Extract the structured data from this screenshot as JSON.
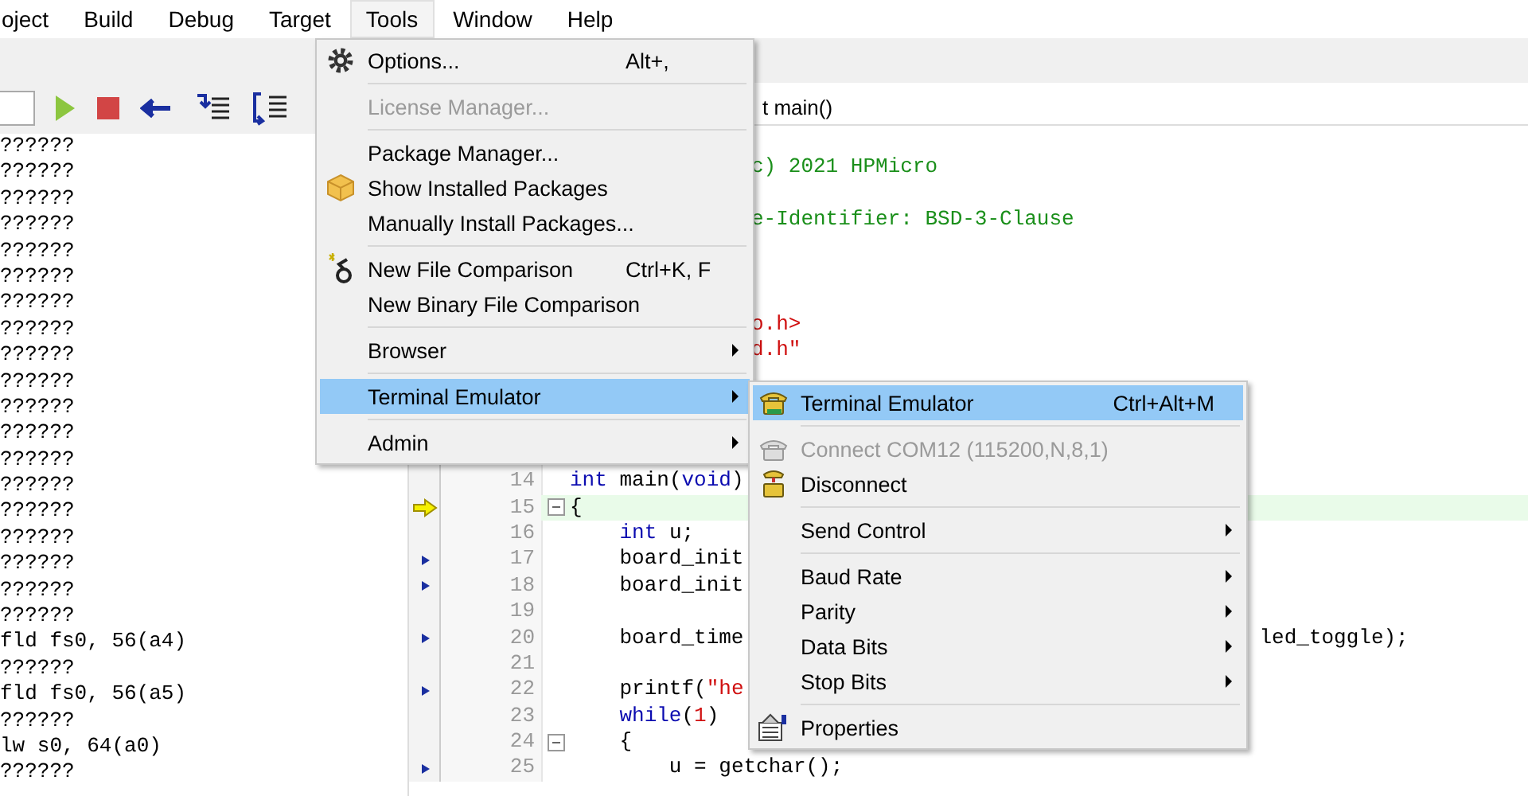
{
  "menubar": [
    {
      "label": "oject",
      "selected": false
    },
    {
      "label": "Build",
      "selected": false
    },
    {
      "label": "Debug",
      "selected": false
    },
    {
      "label": "Target",
      "selected": false
    },
    {
      "label": "Tools",
      "selected": true
    },
    {
      "label": "Window",
      "selected": false
    },
    {
      "label": "Help",
      "selected": false
    }
  ],
  "disassembly": {
    "lines": [
      "??????",
      "??????",
      "??????",
      "??????",
      "??????",
      "??????",
      "??????",
      "??????",
      "??????",
      "??????",
      "??????",
      "??????",
      "??????",
      "??????",
      "??????",
      "??????",
      "??????",
      "??????",
      "??????",
      "fld fs0, 56(a4)",
      "??????",
      "fld fs0, 56(a5)",
      "??????",
      "lw s0, 64(a0)",
      "??????"
    ]
  },
  "editor": {
    "function_box": "t main()",
    "fragments": [
      {
        "kind": "comment",
        "text": "c) 2021 HPMicro"
      },
      {
        "kind": "comment",
        "text": "e-Identifier: BSD-3-Clause"
      },
      {
        "kind": "include",
        "text": "o.h>"
      },
      {
        "kind": "include",
        "text": "d.h\""
      }
    ],
    "lines": [
      {
        "number": "14",
        "executable": false,
        "fold": false,
        "current": false,
        "text": "int main(void)"
      },
      {
        "number": "15",
        "fold": true,
        "current": true,
        "text": "{"
      },
      {
        "number": "16",
        "executable": false,
        "fold": false,
        "current": false,
        "text": "    int u;"
      },
      {
        "number": "17",
        "executable": true,
        "fold": false,
        "current": false,
        "text": "    board_init"
      },
      {
        "number": "18",
        "executable": true,
        "fold": false,
        "current": false,
        "text": "    board_init"
      },
      {
        "number": "19",
        "executable": false,
        "fold": false,
        "current": false
      },
      {
        "number": "20",
        "executable": true,
        "fold": false,
        "current": false,
        "text": "    board_time",
        "tail": "led_toggle);"
      },
      {
        "number": "21",
        "executable": false,
        "fold": false,
        "current": false
      },
      {
        "number": "22",
        "executable": true,
        "fold": false,
        "current": false,
        "text": "    printf(\"he"
      },
      {
        "number": "23",
        "executable": false,
        "fold": false,
        "current": false,
        "text": "    while(1)"
      },
      {
        "number": "24",
        "executable": false,
        "fold": true,
        "current": false,
        "text": "    {"
      },
      {
        "number": "25",
        "executable": true,
        "fold": false,
        "current": false,
        "text": "        u = getchar();"
      }
    ]
  },
  "tools_menu": {
    "items": [
      {
        "kind": "item",
        "label": "Options...",
        "shortcut": "Alt+,",
        "disabled": false,
        "selected": false,
        "submenu": false
      },
      {
        "kind": "separator"
      },
      {
        "kind": "item",
        "label": "License Manager...",
        "disabled": true,
        "selected": false,
        "submenu": false
      },
      {
        "kind": "separator"
      },
      {
        "kind": "item",
        "label": "Package Manager...",
        "disabled": false,
        "selected": false,
        "submenu": false
      },
      {
        "kind": "item",
        "label": "Show Installed Packages",
        "disabled": false,
        "selected": false,
        "submenu": false
      },
      {
        "kind": "item",
        "label": "Manually Install Packages...",
        "disabled": false,
        "selected": false,
        "submenu": false
      },
      {
        "kind": "separator"
      },
      {
        "kind": "item",
        "label": "New File Comparison",
        "shortcut": "Ctrl+K, F",
        "disabled": false,
        "selected": false,
        "submenu": false
      },
      {
        "kind": "item",
        "label": "New Binary File Comparison",
        "disabled": false,
        "selected": false,
        "submenu": false
      },
      {
        "kind": "separator"
      },
      {
        "kind": "item",
        "label": "Browser",
        "disabled": false,
        "selected": false,
        "submenu": true
      },
      {
        "kind": "separator"
      },
      {
        "kind": "item",
        "label": "Terminal Emulator",
        "disabled": false,
        "selected": true,
        "submenu": true
      },
      {
        "kind": "separator"
      },
      {
        "kind": "item",
        "label": "Admin",
        "disabled": false,
        "selected": false,
        "submenu": true
      }
    ]
  },
  "terminal_submenu": {
    "items": [
      {
        "kind": "item",
        "label": "Terminal Emulator",
        "shortcut": "Ctrl+Alt+M",
        "disabled": false,
        "selected": true,
        "submenu": false
      },
      {
        "kind": "separator"
      },
      {
        "kind": "item",
        "label": "Connect COM12 (115200,N,8,1)",
        "disabled": true,
        "selected": false,
        "submenu": false
      },
      {
        "kind": "item",
        "label": "Disconnect",
        "disabled": false,
        "selected": false,
        "submenu": false
      },
      {
        "kind": "separator"
      },
      {
        "kind": "item",
        "label": "Send Control",
        "disabled": false,
        "selected": false,
        "submenu": true
      },
      {
        "kind": "separator"
      },
      {
        "kind": "item",
        "label": "Baud Rate",
        "disabled": false,
        "selected": false,
        "submenu": true
      },
      {
        "kind": "item",
        "label": "Parity",
        "disabled": false,
        "selected": false,
        "submenu": true
      },
      {
        "kind": "item",
        "label": "Data Bits",
        "disabled": false,
        "selected": false,
        "submenu": true
      },
      {
        "kind": "item",
        "label": "Stop Bits",
        "disabled": false,
        "selected": false,
        "submenu": true
      },
      {
        "kind": "separator"
      },
      {
        "kind": "item",
        "label": "Properties",
        "disabled": false,
        "selected": false,
        "submenu": false
      }
    ]
  }
}
